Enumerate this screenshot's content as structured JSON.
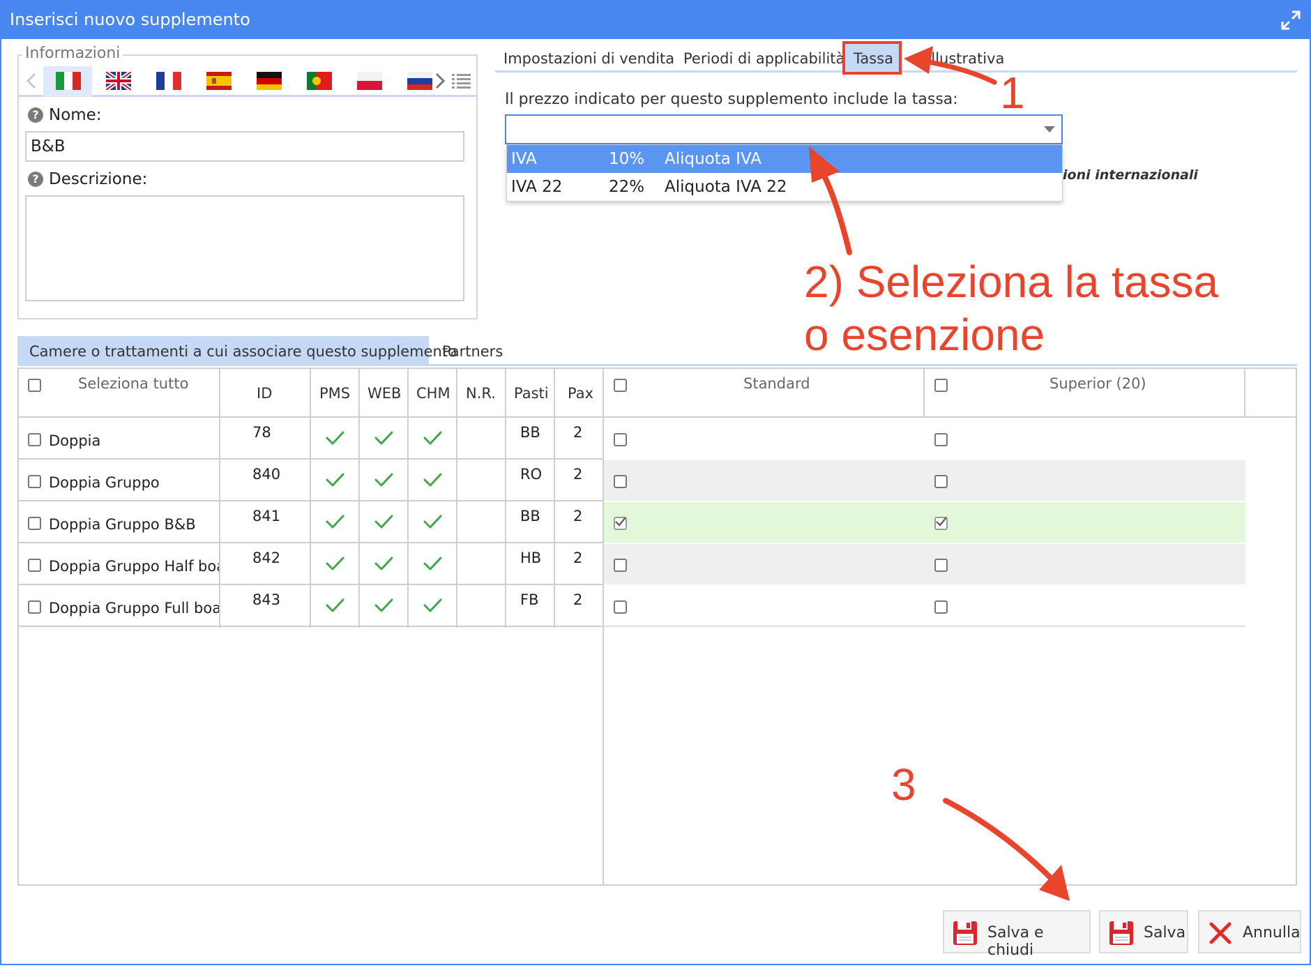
{
  "window": {
    "title": "Inserisci nuovo supplemento"
  },
  "info": {
    "legend": "Informazioni",
    "flags": [
      "it",
      "gb",
      "fr",
      "es",
      "de",
      "pt",
      "pl",
      "ru"
    ],
    "name_label": "Nome:",
    "name_value": "B&B",
    "description_label": "Descrizione:",
    "description_value": ""
  },
  "tabs": {
    "items": [
      "Impostazioni di vendita",
      "Periodi di applicabilità",
      "Tassa",
      "Foto illustrativa"
    ],
    "active": "Tassa",
    "visible_fragment": "o illustrativa"
  },
  "tax": {
    "prompt": "Il prezzo indicato per questo supplemento include la tassa:",
    "selected_value": "",
    "hidden_text_fragment": "ioni internazionali",
    "options": [
      {
        "code": "IVA",
        "rate": "10%",
        "description": "Aliquota IVA",
        "highlighted": true
      },
      {
        "code": "IVA 22",
        "rate": "22%",
        "description": "Aliquota IVA 22",
        "highlighted": false
      }
    ]
  },
  "bottom_tabs": {
    "items": [
      "Camere o trattamenti a cui associare questo supplemento",
      "Partners"
    ],
    "active": "Camere o trattamenti a cui associare questo supplemento"
  },
  "table": {
    "headers": {
      "select_all": "Seleziona tutto",
      "id": "ID",
      "pms": "PMS",
      "web": "WEB",
      "chm": "CHM",
      "nr": "N.R.",
      "pasti": "Pasti",
      "pax": "Pax",
      "standard": "Standard",
      "superior": "Superior (20)"
    },
    "rows": [
      {
        "name": "Doppia",
        "id": "78",
        "pms": true,
        "web": true,
        "chm": true,
        "pasti": "BB",
        "pax": "2",
        "standard": false,
        "superior": false
      },
      {
        "name": "Doppia Gruppo",
        "id": "840",
        "pms": true,
        "web": true,
        "chm": true,
        "pasti": "RO",
        "pax": "2",
        "standard": false,
        "superior": false
      },
      {
        "name": "Doppia Gruppo B&B",
        "id": "841",
        "pms": true,
        "web": true,
        "chm": true,
        "pasti": "BB",
        "pax": "2",
        "standard": true,
        "superior": true
      },
      {
        "name": "Doppia Gruppo Half board",
        "id": "842",
        "pms": true,
        "web": true,
        "chm": true,
        "pasti": "HB",
        "pax": "2",
        "standard": false,
        "superior": false
      },
      {
        "name": "Doppia Gruppo Full board",
        "id": "843",
        "pms": true,
        "web": true,
        "chm": true,
        "pasti": "FB",
        "pax": "2",
        "standard": false,
        "superior": false
      }
    ]
  },
  "buttons": {
    "save_close": "Salva e chiudi",
    "save": "Salva",
    "cancel": "Annulla"
  },
  "annotations": {
    "step1": "1",
    "step2_line1": "2) Seleziona la tassa",
    "step2_line2": "o esenzione",
    "step3": "3"
  },
  "colors": {
    "titlebar": "#4787ef",
    "highlight_row": "#5b95f2",
    "annotation": "#e8452c",
    "check": "#3ea84e",
    "selected_row": "#e2f8d9"
  }
}
